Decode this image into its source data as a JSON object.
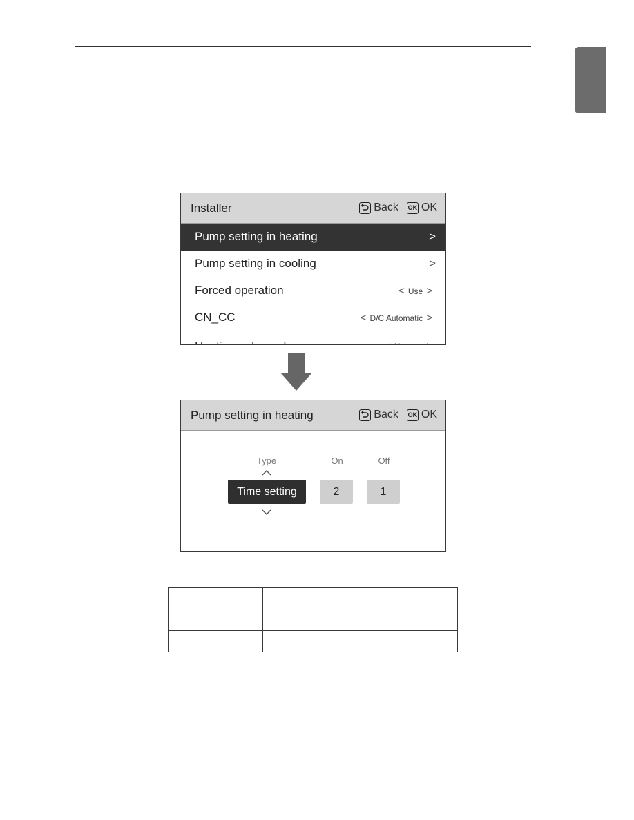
{
  "page": {
    "side_tab_color": "#6d6c6c"
  },
  "screen1": {
    "title": "Installer",
    "back_label": "Back",
    "ok_label": "OK",
    "ok_icon_text": "OK",
    "items": [
      {
        "label": "Pump setting in heating",
        "selected": true,
        "chevron": ">"
      },
      {
        "label": "Pump setting in cooling",
        "chevron": ">"
      },
      {
        "label": "Forced operation",
        "value": "Use"
      },
      {
        "label": "CN_CC",
        "value": "D/C Automatic"
      },
      {
        "label": "Heating only mode",
        "value": "Not use"
      }
    ]
  },
  "screen2": {
    "title": "Pump setting in heating",
    "back_label": "Back",
    "ok_label": "OK",
    "ok_icon_text": "OK",
    "columns": [
      {
        "label": "Type",
        "value": "Time setting"
      },
      {
        "label": "On",
        "value": "2"
      },
      {
        "label": "Off",
        "value": "1"
      }
    ]
  },
  "glyphs": {
    "left": "<",
    "right": ">",
    "up": "^",
    "down": "v"
  },
  "table": {
    "rows": [
      [
        "",
        "",
        ""
      ],
      [
        "",
        "",
        ""
      ],
      [
        "",
        "",
        ""
      ]
    ]
  }
}
